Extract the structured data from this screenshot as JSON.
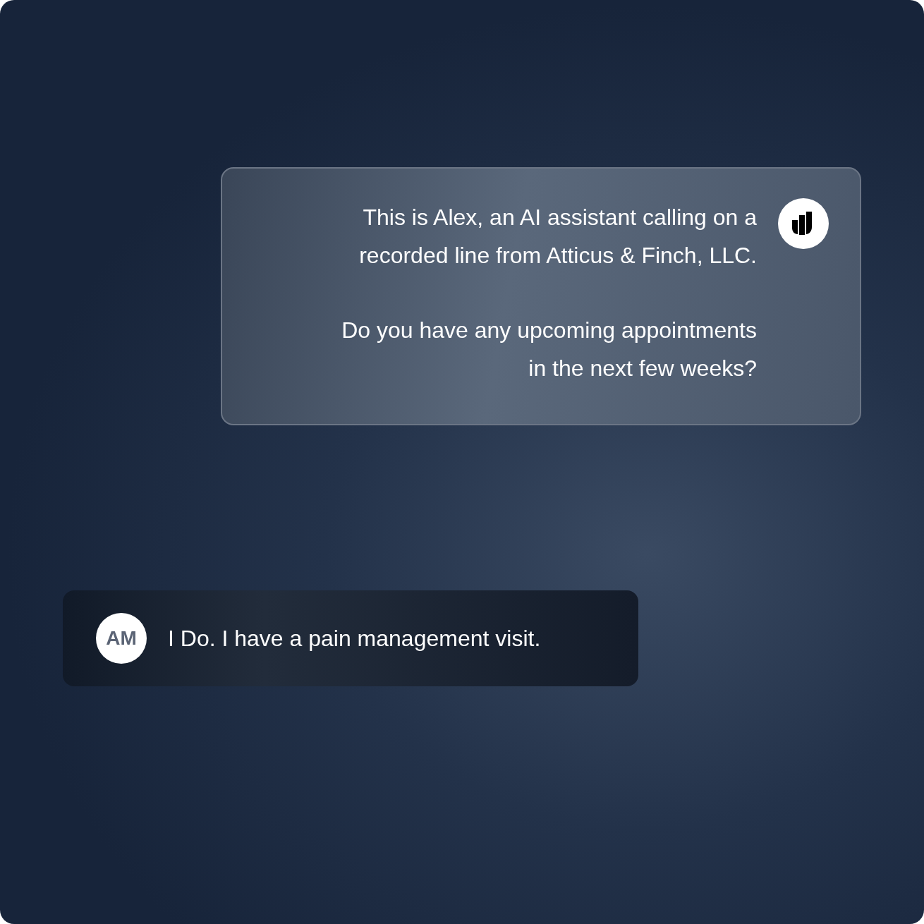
{
  "messages": [
    {
      "kind": "agent",
      "paragraphs": [
        [
          "This is Alex, an AI assistant calling on a",
          "recorded line from Atticus & Finch, LLC."
        ],
        [
          "Do you have any upcoming appointments",
          "in the next few weeks?"
        ]
      ]
    },
    {
      "kind": "caller",
      "avatar": "AM",
      "paragraphs": [
        [
          "I Do. I have a pain management visit."
        ]
      ]
    }
  ]
}
